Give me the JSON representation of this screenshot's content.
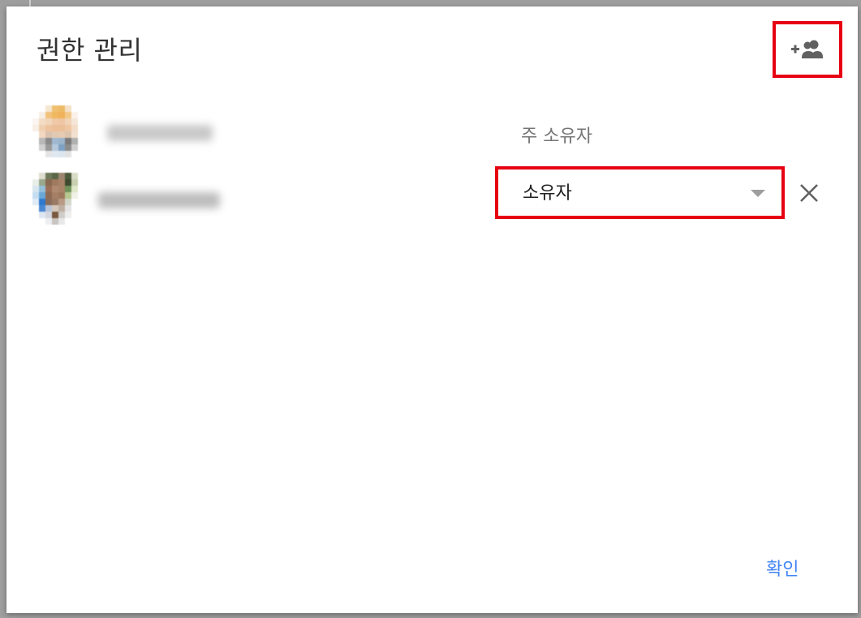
{
  "dialog": {
    "title": "권한 관리",
    "confirm_label": "확인"
  },
  "header": {
    "add_people_icon": "person-add-icon"
  },
  "members": [
    {
      "name": "",
      "role": "주 소유자",
      "editable": false
    },
    {
      "name": "",
      "role": "소유자",
      "editable": true,
      "role_options_selected": "소유자",
      "remove_icon": "close-icon"
    }
  ],
  "colors": {
    "highlight": "#e60012",
    "accent": "#4285f4",
    "muted_text": "#757575",
    "title_text": "#333333"
  }
}
